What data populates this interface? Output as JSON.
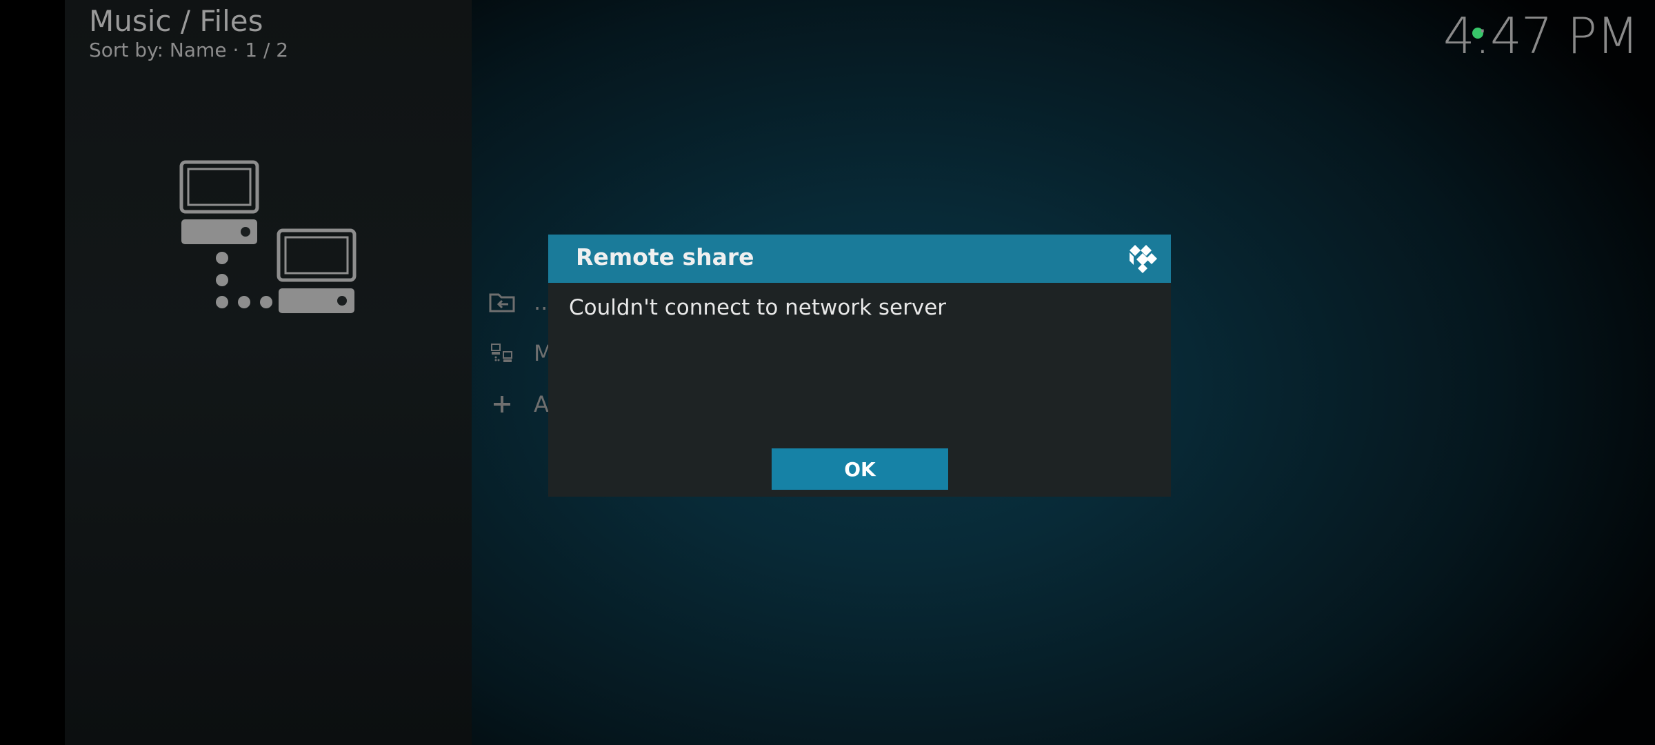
{
  "header": {
    "title": "Music / Files",
    "sort_info": "Sort by: Name  ·  1 / 2"
  },
  "clock": "4:47 PM",
  "status": {
    "indicator_color": "#38c76a"
  },
  "file_list": {
    "items": [
      {
        "icon": "back-folder-icon",
        "label": ".."
      },
      {
        "icon": "network-icon",
        "label": "M"
      },
      {
        "icon": "plus-icon",
        "label": "A"
      }
    ]
  },
  "dialog": {
    "title": "Remote share",
    "message": "Couldn't connect to network server",
    "ok_label": "OK",
    "header_color": "#1a7b9a",
    "button_color": "#1682a6"
  }
}
